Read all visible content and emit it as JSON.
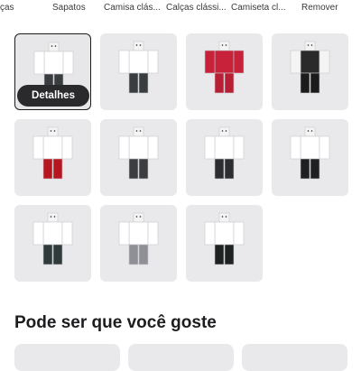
{
  "tabs": [
    {
      "label": "ças"
    },
    {
      "label": "Sapatos"
    },
    {
      "label": "Camisa clás..."
    },
    {
      "label": "Calças clássi..."
    },
    {
      "label": "Camiseta cl..."
    },
    {
      "label": "Remover"
    }
  ],
  "grid": {
    "details_label": "Detalhes",
    "items": [
      {
        "name": "outfit-1",
        "shirt": "#ffffff",
        "pants": "#3a3d40"
      },
      {
        "name": "outfit-2",
        "shirt": "#ffffff",
        "pants": "#3a3d40"
      },
      {
        "name": "outfit-3",
        "shirt": "#c8213a",
        "pants": "#b81f35"
      },
      {
        "name": "outfit-4",
        "shirt": "#2a2a2a",
        "pants": "#1b1b1b"
      },
      {
        "name": "outfit-5",
        "shirt": "#ffffff",
        "pants": "#b5161f"
      },
      {
        "name": "outfit-6",
        "shirt": "#ffffff",
        "pants": "#3b3d41"
      },
      {
        "name": "outfit-7",
        "shirt": "#ffffff",
        "pants": "#2b2d30"
      },
      {
        "name": "outfit-8",
        "shirt": "#ffffff",
        "pants": "#1f2022"
      },
      {
        "name": "outfit-9",
        "shirt": "#ffffff",
        "pants": "#2f3b3a"
      },
      {
        "name": "outfit-10",
        "shirt": "#ffffff",
        "pants": "#8f9096"
      },
      {
        "name": "outfit-11",
        "shirt": "#ffffff",
        "pants": "#1e2321"
      }
    ]
  },
  "recommendations": {
    "title": "Pode ser que você goste"
  }
}
